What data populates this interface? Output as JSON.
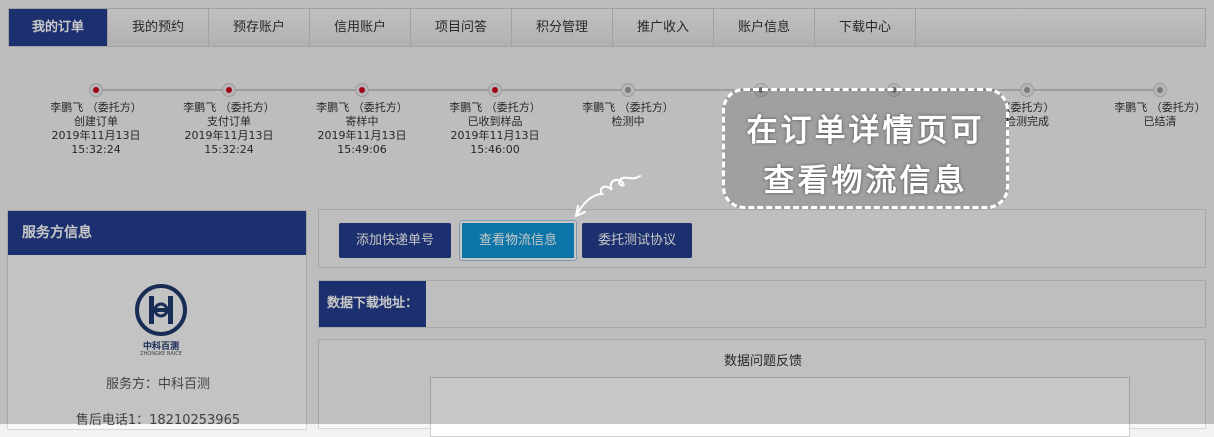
{
  "tabs": [
    {
      "label": "我的订单",
      "active": true
    },
    {
      "label": "我的预约"
    },
    {
      "label": "预存账户"
    },
    {
      "label": "信用账户"
    },
    {
      "label": "项目问答"
    },
    {
      "label": "积分管理"
    },
    {
      "label": "推广收入"
    },
    {
      "label": "账户信息"
    },
    {
      "label": "下载中心"
    }
  ],
  "timeline": [
    {
      "actor": "李鹏飞 （委托方）",
      "status": "创建订单",
      "date": "2019年11月13日",
      "time": "15:32:24",
      "done": true
    },
    {
      "actor": "李鹏飞 （委托方）",
      "status": "支付订单",
      "date": "2019年11月13日",
      "time": "15:32:24",
      "done": true
    },
    {
      "actor": "李鹏飞 （委托方）",
      "status": "寄样中",
      "date": "2019年11月13日",
      "time": "15:49:06",
      "done": true
    },
    {
      "actor": "李鹏飞 （委托方）",
      "status": "已收到样品",
      "date": "2019年11月13日",
      "time": "15:46:00",
      "done": true
    },
    {
      "actor": "李鹏飞 （委托方）",
      "status": "检测中",
      "date": "",
      "time": "",
      "done": false
    },
    {
      "actor": "",
      "status": "",
      "date": "",
      "time": "",
      "done": false
    },
    {
      "actor": "",
      "status": "",
      "date": "",
      "time": "",
      "done": false
    },
    {
      "actor": "",
      "status": "",
      "date": "",
      "time": "",
      "done": false
    },
    {
      "actor": "（委托方）",
      "status": "检测完成",
      "date": "",
      "time": "",
      "done": false
    },
    {
      "actor": "李鹏飞 （委托方）",
      "status": "已结清",
      "date": "",
      "time": "",
      "done": false
    }
  ],
  "provider": {
    "title": "服务方信息",
    "logo_text": "中科百测",
    "logo_sub": "ZHONGKE BAICE",
    "service_line": "服务方：中科百测",
    "phone_line": "售后电话1：18210253965"
  },
  "actions": {
    "add_express": "添加快递单号",
    "view_logistics": "查看物流信息",
    "agreement": "委托测试协议"
  },
  "download": {
    "label": "数据下载地址："
  },
  "feedback": {
    "title": "数据问题反馈"
  },
  "callout": {
    "line1": "在订单详情页可",
    "line2": "查看物流信息"
  },
  "colors": {
    "navy": "#253e8f",
    "highlight": "#1097d6",
    "done_dot": "#d0021b"
  }
}
